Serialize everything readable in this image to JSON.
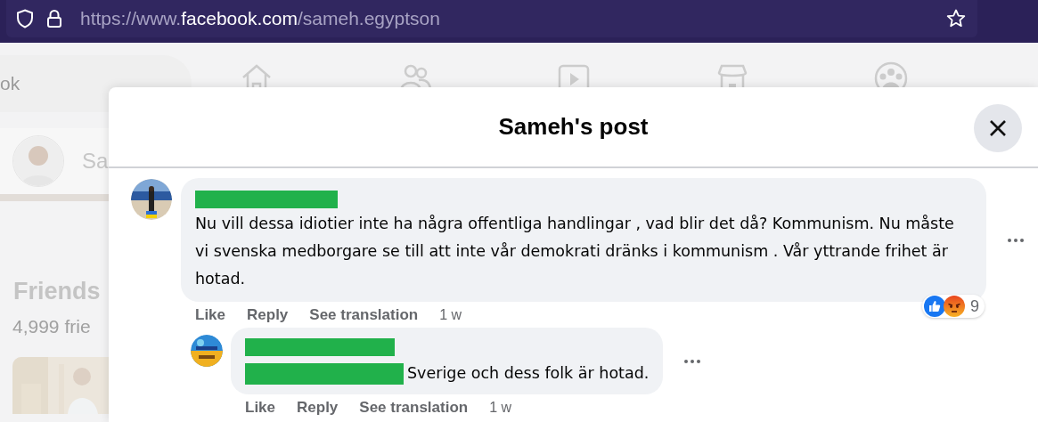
{
  "browser": {
    "url_prefix": "https://www.",
    "url_domain": "facebook.com",
    "url_path": "/sameh.egyptson"
  },
  "background": {
    "search_placeholder": "ok",
    "profile_name": "Sa",
    "friends_title": "Friends",
    "friends_count": "4,999 frie"
  },
  "dialog": {
    "title": "Sameh's post"
  },
  "comments": [
    {
      "author_redacted": true,
      "text": "Nu vill dessa idiotier inte ha några offentliga handlingar , vad blir det då? Kommunism. Nu måste vi svenska medborgare se till att inte vår demokrati dränks i kommunism . Vår yttrande frihet är hotad.",
      "reactions": {
        "count": "9"
      },
      "actions": [
        "Like",
        "Reply",
        "See translation"
      ],
      "time": "1 w",
      "replies": [
        {
          "author_redacted": true,
          "text_redacted": true,
          "text": "Sverige och dess folk är hotad.",
          "actions": [
            "Like",
            "Reply",
            "See translation"
          ],
          "time": "1 w"
        }
      ]
    }
  ]
}
